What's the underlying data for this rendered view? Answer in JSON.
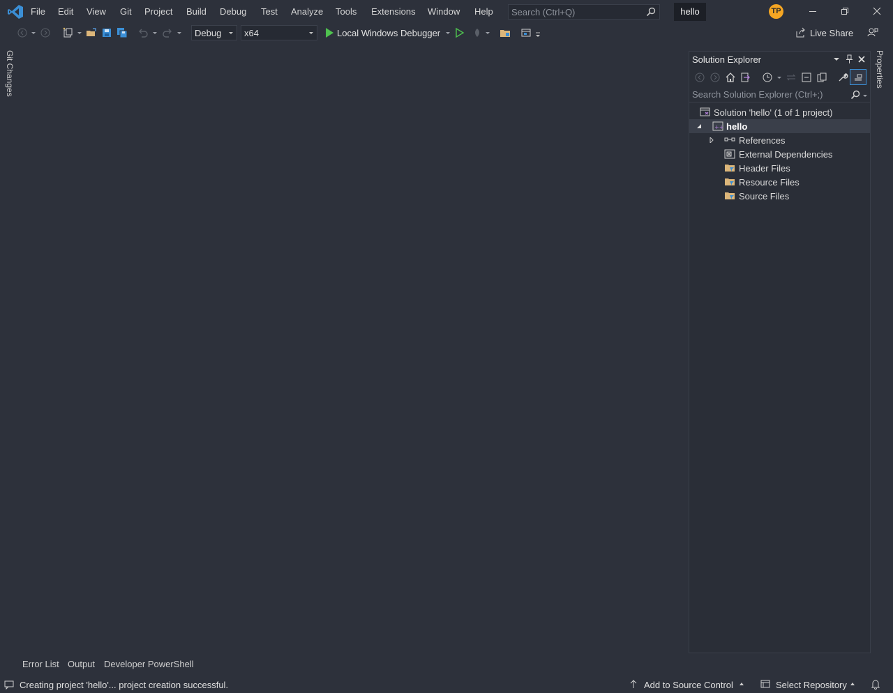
{
  "titlebar": {
    "menu": [
      "File",
      "Edit",
      "View",
      "Git",
      "Project",
      "Build",
      "Debug",
      "Test",
      "Analyze",
      "Tools",
      "Extensions",
      "Window",
      "Help"
    ],
    "search_placeholder": "Search (Ctrl+Q)",
    "solution_name": "hello",
    "avatar_initials": "TP"
  },
  "toolbar": {
    "configuration": "Debug",
    "platform": "x64",
    "run_target": "Local Windows Debugger",
    "live_share": "Live Share"
  },
  "side_tabs": {
    "left": "Git Changes",
    "right": "Properties"
  },
  "solution_explorer": {
    "title": "Solution Explorer",
    "search_placeholder": "Search Solution Explorer (Ctrl+;)",
    "tree": {
      "solution": "Solution 'hello' (1 of 1 project)",
      "project": "hello",
      "items": [
        "References",
        "External Dependencies",
        "Header Files",
        "Resource Files",
        "Source Files"
      ]
    }
  },
  "bottom_tabs": [
    "Error List",
    "Output",
    "Developer PowerShell"
  ],
  "statusbar": {
    "message": "Creating project 'hello'... project creation successful.",
    "source_control": "Add to Source Control",
    "repository": "Select Repository"
  }
}
